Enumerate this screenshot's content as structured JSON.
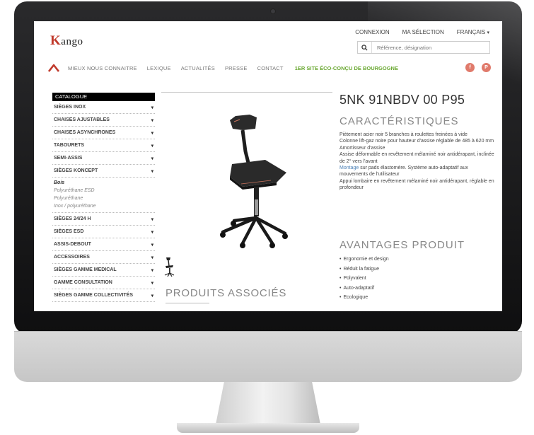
{
  "site": {
    "logo_k": "K",
    "logo_text": "ango"
  },
  "toplinks": {
    "login": "CONNEXION",
    "selection": "MA SÉLECTION",
    "language": "FRANÇAIS",
    "language_caret": "▾"
  },
  "search": {
    "placeholder": "Référence, désignation",
    "icon": "search-icon"
  },
  "nav": {
    "items": [
      "MIEUX NOUS CONNAITRE",
      "LEXIQUE",
      "ACTUALITÉS",
      "PRESSE",
      "CONTACT"
    ],
    "eco": "1ER SITE ÉCO-CONÇU DE BOURGOGNE",
    "social": [
      "f",
      "P"
    ]
  },
  "sidebar": {
    "header": "CATALOGUE",
    "items": [
      {
        "label": "SIÈGES INOX"
      },
      {
        "label": "CHAISES AJUSTABLES"
      },
      {
        "label": "CHAISES ASYNCHRONES"
      },
      {
        "label": "TABOURETS"
      },
      {
        "label": "SEMI-ASSIS"
      },
      {
        "label": "SIÈGES KONCEPT"
      }
    ],
    "subitems": [
      "Bois",
      "Polyuréthane ESD",
      "Polyuréthane",
      "Inox / polyuréthane"
    ],
    "items_after": [
      {
        "label": "SIÈGES 24/24 H"
      },
      {
        "label": "SIÈGES ESD"
      },
      {
        "label": "ASSIS-DEBOUT"
      },
      {
        "label": "ACCESSOIRES"
      },
      {
        "label": "SIÈGES GAMME MEDICAL"
      },
      {
        "label": "GAMME CONSULTATION"
      },
      {
        "label": "SIÈGES GAMME COLLECTIVITÉS"
      }
    ],
    "chevron": "▾"
  },
  "product": {
    "reference": "5NK 91NBDV 00 P95",
    "characteristics_title": "CARACTÉRISTIQUES",
    "description": {
      "line1": "Piètement acier noir 5 branches à roulettes freinées à vide",
      "line2": "Colonne lift-gaz noire pour hauteur d'assise réglable de 485 à 620 mm",
      "line3": "Amortisseur d'assise",
      "line4": "Assise déformable en revêtement mélaminé noir antidérapant, inclinée de 2° vers l'avant",
      "link": "Montage",
      "line5": " sur pads élastomère. Système auto-adaptatif aux mouvements de l'utilisateur",
      "line6": "Appui lombaire en revêtement mélaminé noir antidérapant, réglable en profondeur"
    },
    "advantages_title": "AVANTAGES PRODUIT",
    "advantages": [
      "Ergonomie et design",
      "Réduit la fatigue",
      "Polyvalent",
      "Auto-adaptatif",
      "Ecologique"
    ],
    "related_title": "PRODUITS ASSOCIÉS"
  },
  "colors": {
    "accent_red": "#c0392b",
    "eco_green": "#6aa832",
    "link_blue": "#4a7fb5"
  }
}
